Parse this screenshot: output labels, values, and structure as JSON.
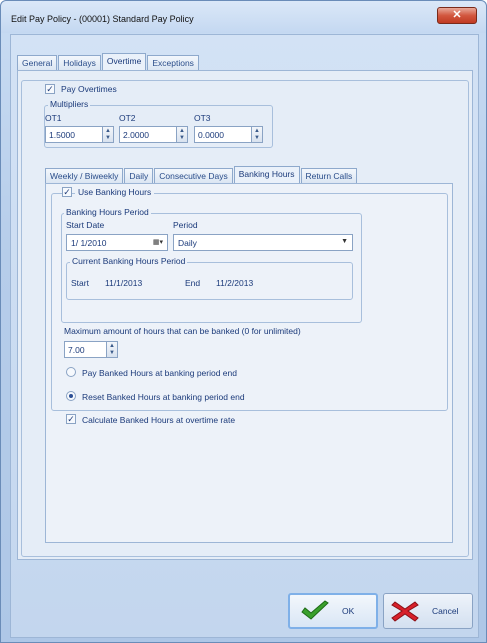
{
  "window": {
    "title": "Edit Pay Policy - (00001) Standard Pay Policy",
    "close_glyph": "✕"
  },
  "main_tabs": [
    {
      "label": "General"
    },
    {
      "label": "Holidays"
    },
    {
      "label": "Overtime"
    },
    {
      "label": "Exceptions"
    }
  ],
  "pay_overtimes": {
    "label": "Pay Overtimes",
    "checked": true,
    "check_glyph": "✓"
  },
  "multipliers": {
    "title": "Multipliers",
    "ot1": {
      "label": "OT1",
      "value": "1.5000"
    },
    "ot2": {
      "label": "OT2",
      "value": "2.0000"
    },
    "ot3": {
      "label": "OT3",
      "value": "0.0000"
    }
  },
  "sub_tabs": [
    {
      "label": "Weekly / Biweekly"
    },
    {
      "label": "Daily"
    },
    {
      "label": "Consecutive Days"
    },
    {
      "label": "Banking Hours"
    },
    {
      "label": "Return Calls"
    }
  ],
  "use_banking": {
    "label": "Use Banking Hours",
    "checked": true
  },
  "banking_period": {
    "title": "Banking Hours Period",
    "start_date_label": "Start Date",
    "start_date_value": "1/ 1/2010",
    "period_label": "Period",
    "period_value": "Daily"
  },
  "current_period": {
    "title": "Current Banking Hours Period",
    "start_label": "Start",
    "start_value": "11/1/2013",
    "end_label": "End",
    "end_value": "11/2/2013"
  },
  "max_hours": {
    "label": "Maximum amount of hours that can be banked (0 for unlimited)",
    "value": "7.00"
  },
  "options": {
    "pay_banked": {
      "label": "Pay Banked Hours at banking period end",
      "selected": false
    },
    "reset_banked": {
      "label": "Reset Banked Hours at banking period end",
      "selected": true
    },
    "calc_overtime": {
      "label": "Calculate Banked Hours at overtime rate",
      "checked": true
    }
  },
  "buttons": {
    "ok": "OK",
    "cancel": "Cancel"
  },
  "colors": {
    "ok_icon": "#3aa02c",
    "cancel_icon": "#d8202a",
    "accent": "#1b3a7a"
  }
}
